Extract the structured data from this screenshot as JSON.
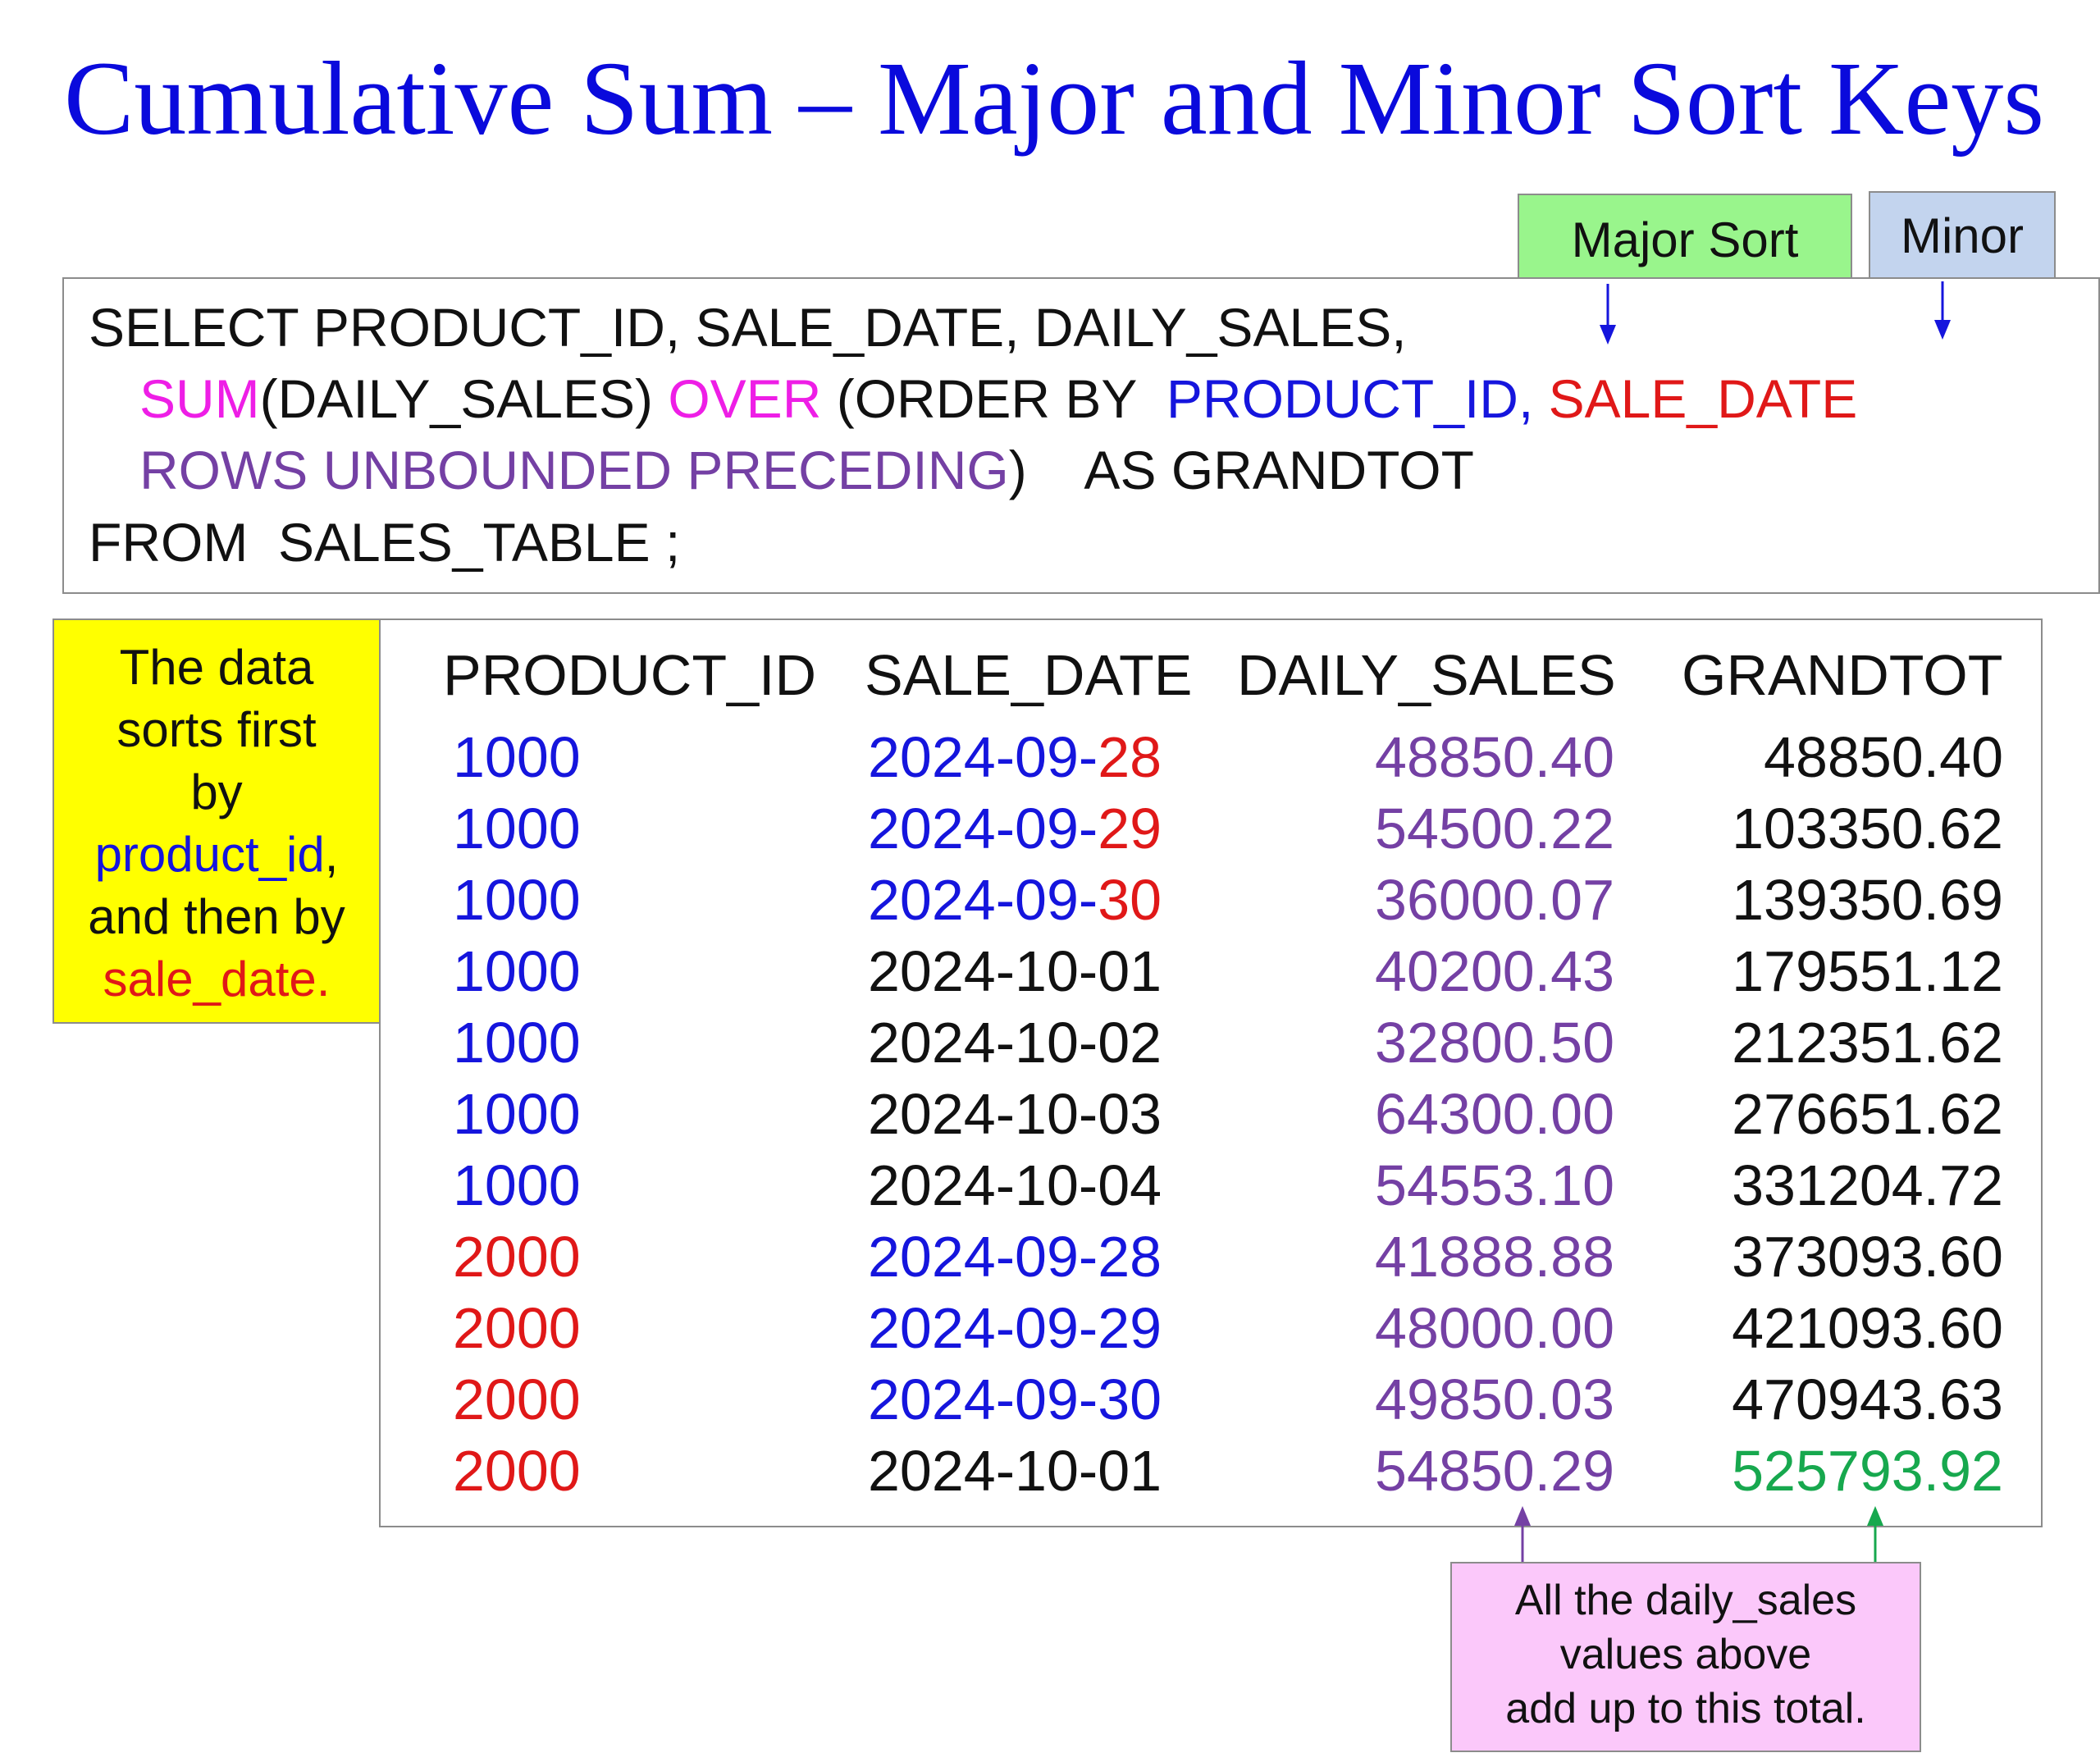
{
  "title": "Cumulative Sum – Major and Minor Sort Keys",
  "labels": {
    "major_sort": "Major Sort",
    "minor": "Minor"
  },
  "sql": {
    "line1": "SELECT PRODUCT_ID, SALE_DATE, DAILY_SALES,",
    "line2": {
      "sum": "SUM",
      "arg": "(DAILY_SALES) ",
      "over": "OVER",
      "order": " (ORDER BY  ",
      "major": "PRODUCT_ID,",
      "minor": "SALE_DATE"
    },
    "line3": {
      "rows": "ROWS UNBOUNDED PRECEDING",
      "alias": ")    AS GRANDTOT"
    },
    "line4": "FROM  SALES_TABLE ;"
  },
  "side_note": {
    "lines": [
      "The data",
      "sorts first",
      "by"
    ],
    "key1": "product_id",
    "key1_suffix": ",",
    "line_and": "and then by",
    "key2": "sale_date."
  },
  "table": {
    "headers": [
      "PRODUCT_ID",
      "SALE_DATE",
      "DAILY_SALES",
      "GRANDTOT"
    ],
    "rows": [
      {
        "product_id": "1000",
        "date_prefix": "2024-09-",
        "date_suffix": "28",
        "daily_sales": "48850.40",
        "grandtot": "48850.40"
      },
      {
        "product_id": "1000",
        "date_prefix": "2024-09-",
        "date_suffix": "29",
        "daily_sales": "54500.22",
        "grandtot": "103350.62"
      },
      {
        "product_id": "1000",
        "date_prefix": "2024-09-",
        "date_suffix": "30",
        "daily_sales": "36000.07",
        "grandtot": "139350.69"
      },
      {
        "product_id": "1000",
        "date_prefix": "2024-10-01",
        "date_suffix": "",
        "daily_sales": "40200.43",
        "grandtot": "179551.12"
      },
      {
        "product_id": "1000",
        "date_prefix": "2024-10-02",
        "date_suffix": "",
        "daily_sales": "32800.50",
        "grandtot": "212351.62"
      },
      {
        "product_id": "1000",
        "date_prefix": "2024-10-03",
        "date_suffix": "",
        "daily_sales": "64300.00",
        "grandtot": "276651.62"
      },
      {
        "product_id": "1000",
        "date_prefix": "2024-10-04",
        "date_suffix": "",
        "daily_sales": "54553.10",
        "grandtot": "331204.72"
      },
      {
        "product_id": "2000",
        "date_prefix": "2024-09-28",
        "date_suffix": "",
        "daily_sales": "41888.88",
        "grandtot": "373093.60"
      },
      {
        "product_id": "2000",
        "date_prefix": "2024-09-29",
        "date_suffix": "",
        "daily_sales": "48000.00",
        "grandtot": "421093.60"
      },
      {
        "product_id": "2000",
        "date_prefix": "2024-09-30",
        "date_suffix": "",
        "daily_sales": "49850.03",
        "grandtot": "470943.63"
      },
      {
        "product_id": "2000",
        "date_prefix": "2024-10-01",
        "date_suffix": "",
        "daily_sales": "54850.29",
        "grandtot": "525793.92"
      }
    ]
  },
  "bottom_note": {
    "lines": [
      "All the daily_sales",
      "values above",
      "add up to this total."
    ]
  },
  "colors": {
    "title": "#0a0adc",
    "major_key": "#1515dd",
    "minor_key": "#e01818",
    "sum_over": "#ee1ee6",
    "rows_clause": "#7440a4",
    "total": "#17a84e",
    "major_tag_bg": "#99f58c",
    "minor_tag_bg": "#c3d4ee",
    "side_note_bg": "#ffff00",
    "bottom_note_bg": "#fbc8fa"
  }
}
